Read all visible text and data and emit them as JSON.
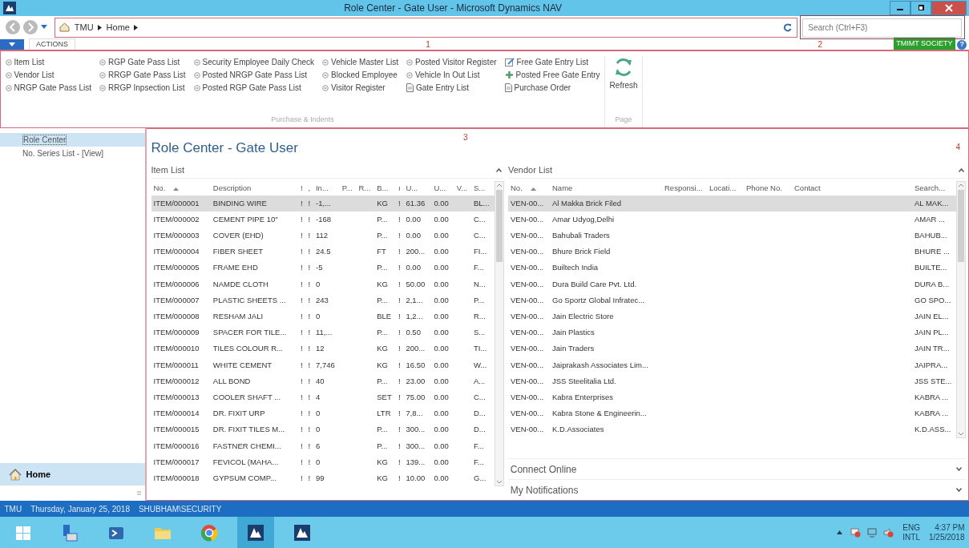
{
  "window": {
    "title": "Role Center - Gate User - Microsoft Dynamics NAV"
  },
  "address_bar": {
    "breadcrumbs": [
      "TMU",
      "Home"
    ],
    "annotation": "1"
  },
  "search": {
    "placeholder": "Search (Ctrl+F3)",
    "annotation": "2"
  },
  "ribbon": {
    "tab": "ACTIONS",
    "company": "TMIMT SOCIETY",
    "help": "?",
    "groups": [
      {
        "title": "Purchase & Indents",
        "items": [
          {
            "label": "Item List",
            "kind": "list"
          },
          {
            "label": "Vendor List",
            "kind": "list"
          },
          {
            "label": "NRGP Gate Pass List",
            "kind": "list"
          },
          {
            "label": "RGP Gate Pass List",
            "kind": "list"
          },
          {
            "label": "RRGP Gate Pass List",
            "kind": "list"
          },
          {
            "label": "RRGP Inpsection  List",
            "kind": "list"
          },
          {
            "label": "Security Employee Daily Check",
            "kind": "list"
          },
          {
            "label": "Posted NRGP Gate Pass List",
            "kind": "list"
          },
          {
            "label": "Posted RGP Gate Pass List",
            "kind": "list"
          },
          {
            "label": "Vehicle Master List",
            "kind": "list"
          },
          {
            "label": "Blocked Employee",
            "kind": "list"
          },
          {
            "label": "Visitor Register",
            "kind": "list"
          },
          {
            "label": "Posted Visitor Register",
            "kind": "list"
          },
          {
            "label": "Vehicle In Out List",
            "kind": "list"
          },
          {
            "label": "Gate Entry List",
            "kind": "document"
          },
          {
            "label": "Free Gate Entry List",
            "kind": "edit"
          },
          {
            "label": "Posted Free Gate Entry",
            "kind": "add"
          },
          {
            "label": "Purchase Order",
            "kind": "document"
          }
        ]
      },
      {
        "title": "Page",
        "items": [
          {
            "label": "Refresh",
            "kind": "refresh"
          }
        ]
      }
    ]
  },
  "sidebar": {
    "items": [
      {
        "label": "Role Center",
        "selected": true
      },
      {
        "label": "No. Series List - [View]",
        "selected": false
      }
    ],
    "buttons": [
      {
        "label": "Home",
        "selected": true
      }
    ]
  },
  "main": {
    "title": "Role Center - Gate User",
    "annotation": "3",
    "corner_annotation": "4"
  },
  "item_list": {
    "title": "Item List",
    "expanded": true,
    "columns": [
      {
        "label": "No.",
        "sorted": true
      },
      {
        "label": "Description",
        "sorted": false
      },
      {
        "label": "!",
        "sorted": false
      },
      {
        "label": ",",
        "sorted": false
      },
      {
        "label": "In...",
        "sorted": false
      },
      {
        "label": "P...",
        "sorted": false
      },
      {
        "label": "R...",
        "sorted": false
      },
      {
        "label": "B...",
        "sorted": false
      },
      {
        "label": "ı",
        "sorted": false
      },
      {
        "label": "U...",
        "sorted": false
      },
      {
        "label": "U...",
        "sorted": false
      },
      {
        "label": "V...",
        "sorted": false
      },
      {
        "label": "S...",
        "sorted": false
      }
    ],
    "rows": [
      {
        "selected": true,
        "cells": [
          "ITEM/000001",
          "BINDING WIRE",
          "!",
          "!",
          "-1,...",
          null,
          null,
          "KG",
          "!",
          "61.36",
          "0.00",
          null,
          "BL..."
        ]
      },
      {
        "selected": false,
        "cells": [
          "ITEM/000002",
          "CEMENT PIPE 10\"",
          "!",
          "!",
          "-168",
          null,
          null,
          "P...",
          "!",
          "0.00",
          "0.00",
          null,
          "C..."
        ]
      },
      {
        "selected": false,
        "cells": [
          "ITEM/000003",
          "COVER (EHD)",
          "!",
          "!",
          "112",
          null,
          null,
          "P...",
          "!",
          "0.00",
          "0.00",
          null,
          "C..."
        ]
      },
      {
        "selected": false,
        "cells": [
          "ITEM/000004",
          "FIBER SHEET",
          "!",
          "!",
          "24.5",
          null,
          null,
          "FT",
          "!",
          "200...",
          "0.00",
          null,
          "FI..."
        ]
      },
      {
        "selected": false,
        "cells": [
          "ITEM/000005",
          "FRAME EHD",
          "!",
          "!",
          "-5",
          null,
          null,
          "P...",
          "!",
          "0.00",
          "0.00",
          null,
          "F..."
        ]
      },
      {
        "selected": false,
        "cells": [
          "ITEM/000006",
          "NAMDE CLOTH",
          "!",
          "!",
          "0",
          null,
          null,
          "KG",
          "!",
          "50.00",
          "0.00",
          null,
          "N..."
        ]
      },
      {
        "selected": false,
        "cells": [
          "ITEM/000007",
          "PLASTIC SHEETS ...",
          "!",
          "!",
          "243",
          null,
          null,
          "P...",
          "!",
          "2,1...",
          "0.00",
          null,
          "P..."
        ]
      },
      {
        "selected": false,
        "cells": [
          "ITEM/000008",
          "RESHAM JALI",
          "!",
          "!",
          "0",
          null,
          null,
          "BLE",
          "!",
          "1,2...",
          "0.00",
          null,
          "R..."
        ]
      },
      {
        "selected": false,
        "cells": [
          "ITEM/000009",
          "SPACER FOR TILE...",
          "!",
          "!",
          "11,...",
          null,
          null,
          "P...",
          "!",
          "0.50",
          "0.00",
          null,
          "S..."
        ]
      },
      {
        "selected": false,
        "cells": [
          "ITEM/000010",
          "TILES COLOUR R...",
          "!",
          "!",
          "12",
          null,
          null,
          "KG",
          "!",
          "200...",
          "0.00",
          null,
          "TI..."
        ]
      },
      {
        "selected": false,
        "cells": [
          "ITEM/000011",
          "WHITE CEMENT",
          "!",
          "!",
          "7,746",
          null,
          null,
          "KG",
          "!",
          "16.50",
          "0.00",
          null,
          "W..."
        ]
      },
      {
        "selected": false,
        "cells": [
          "ITEM/000012",
          "ALL BOND",
          "!",
          "!",
          "40",
          null,
          null,
          "P...",
          "!",
          "23.00",
          "0.00",
          null,
          "A..."
        ]
      },
      {
        "selected": false,
        "cells": [
          "ITEM/000013",
          "COOLER SHAFT ...",
          "!",
          "!",
          "4",
          null,
          null,
          "SET",
          "!",
          "75.00",
          "0.00",
          null,
          "C..."
        ]
      },
      {
        "selected": false,
        "cells": [
          "ITEM/000014",
          "DR. FIXIT URP",
          "!",
          "!",
          "0",
          null,
          null,
          "LTR",
          "!",
          "7,8...",
          "0.00",
          null,
          "D..."
        ]
      },
      {
        "selected": false,
        "cells": [
          "ITEM/000015",
          "DR. FIXIT TILES M...",
          "!",
          "!",
          "0",
          null,
          null,
          "P...",
          "!",
          "300...",
          "0.00",
          null,
          "D..."
        ]
      },
      {
        "selected": false,
        "cells": [
          "ITEM/000016",
          "FASTNER CHEMI...",
          "!",
          "!",
          "6",
          null,
          null,
          "P...",
          "!",
          "300...",
          "0.00",
          null,
          "F..."
        ]
      },
      {
        "selected": false,
        "cells": [
          "ITEM/000017",
          "FEVICOL (MAHA...",
          "!",
          "!",
          "0",
          null,
          null,
          "KG",
          "!",
          "139...",
          "0.00",
          null,
          "F..."
        ]
      },
      {
        "selected": false,
        "cells": [
          "ITEM/000018",
          "GYPSUM COMP...",
          "!",
          "!",
          "99",
          null,
          null,
          "KG",
          "!",
          "10.00",
          "0.00",
          null,
          "G..."
        ]
      }
    ]
  },
  "vendor_list": {
    "title": "Vendor List",
    "expanded": true,
    "columns": [
      {
        "label": "No.",
        "sorted": true
      },
      {
        "label": "Name",
        "sorted": false
      },
      {
        "label": "Responsi...",
        "sorted": false
      },
      {
        "label": "Locati...",
        "sorted": false
      },
      {
        "label": "Phone No.",
        "sorted": false
      },
      {
        "label": "Contact",
        "sorted": false
      },
      {
        "label": "Search...",
        "sorted": false
      }
    ],
    "rows": [
      {
        "selected": true,
        "cells": [
          "VEN-00...",
          "Al Makka Brick Filed",
          null,
          null,
          null,
          null,
          "AL MAK..."
        ]
      },
      {
        "selected": false,
        "cells": [
          "VEN-00...",
          "Amar Udyog,Delhi",
          null,
          null,
          null,
          null,
          "AMAR ..."
        ]
      },
      {
        "selected": false,
        "cells": [
          "VEN-00...",
          "Bahubali Traders",
          null,
          null,
          null,
          null,
          "BAHUB..."
        ]
      },
      {
        "selected": false,
        "cells": [
          "VEN-00...",
          "Bhure Brick Field",
          null,
          null,
          null,
          null,
          "BHURE ..."
        ]
      },
      {
        "selected": false,
        "cells": [
          "VEN-00...",
          "Builtech India",
          null,
          null,
          null,
          null,
          "BUILTE..."
        ]
      },
      {
        "selected": false,
        "cells": [
          "VEN-00...",
          "Dura Build Care Pvt. Ltd.",
          null,
          null,
          null,
          null,
          "DURA B..."
        ]
      },
      {
        "selected": false,
        "cells": [
          "VEN-00...",
          "Go Sportz Global Infratec...",
          null,
          null,
          null,
          null,
          "GO SPO..."
        ]
      },
      {
        "selected": false,
        "cells": [
          "VEN-00...",
          "Jain Electric Store",
          null,
          null,
          null,
          null,
          "JAIN EL..."
        ]
      },
      {
        "selected": false,
        "cells": [
          "VEN-00...",
          "Jain Plastics",
          null,
          null,
          null,
          null,
          "JAIN PL..."
        ]
      },
      {
        "selected": false,
        "cells": [
          "VEN-00...",
          "Jain Traders",
          null,
          null,
          null,
          null,
          "JAIN TR..."
        ]
      },
      {
        "selected": false,
        "cells": [
          "VEN-00...",
          "Jaiprakash Associates Lim...",
          null,
          null,
          null,
          null,
          "JAIPRA..."
        ]
      },
      {
        "selected": false,
        "cells": [
          "VEN-00...",
          "JSS Steelitalia Ltd.",
          null,
          null,
          null,
          null,
          "JSS STE..."
        ]
      },
      {
        "selected": false,
        "cells": [
          "VEN-00...",
          "Kabra Enterprises",
          null,
          null,
          null,
          null,
          "KABRA ..."
        ]
      },
      {
        "selected": false,
        "cells": [
          "VEN-00...",
          "Kabra Stone & Engineerin...",
          null,
          null,
          null,
          null,
          "KABRA ..."
        ]
      },
      {
        "selected": false,
        "cells": [
          "VEN-00...",
          "K.D.Associates",
          null,
          null,
          null,
          null,
          "K.D.ASS..."
        ]
      }
    ]
  },
  "parts": [
    {
      "title": "Connect Online",
      "expanded": false
    },
    {
      "title": "My Notifications",
      "expanded": false
    }
  ],
  "status_bar": [
    "TMU",
    "Thursday, January 25, 2018",
    "SHUBHAM\\SECURITY"
  ],
  "taskbar": {
    "apps": [
      {
        "kind": "start",
        "active": false
      },
      {
        "kind": "server",
        "active": false
      },
      {
        "kind": "shell",
        "active": false
      },
      {
        "kind": "folder",
        "active": false
      },
      {
        "kind": "browser",
        "active": false
      },
      {
        "kind": "nav",
        "active": true
      },
      {
        "kind": "nav",
        "active": false
      }
    ],
    "language": [
      "ENG",
      "INTL"
    ],
    "time": "4:37 PM",
    "date": "1/25/2018"
  }
}
